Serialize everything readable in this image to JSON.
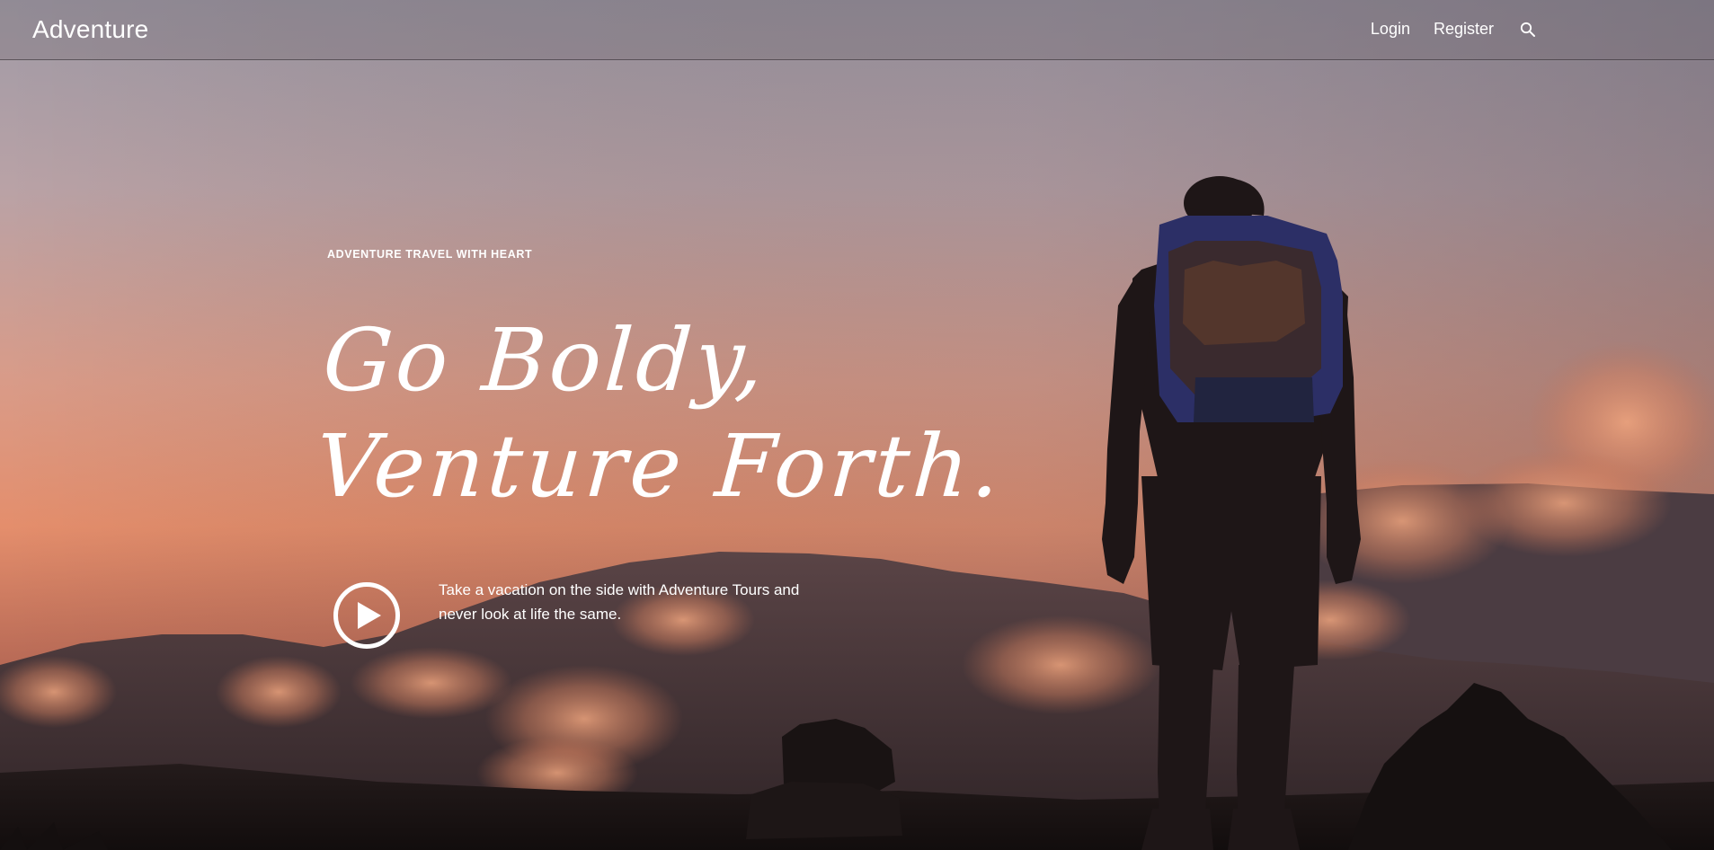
{
  "navbar": {
    "brand": "Adventure",
    "links": [
      {
        "label": "Login"
      },
      {
        "label": "Register"
      }
    ],
    "search_icon": "search-icon"
  },
  "hero": {
    "eyebrow": "ADVENTURE TRAVEL WITH HEART",
    "headline_line1": "Go Boldy,",
    "headline_line2": "Venture Forth.",
    "play_icon": "play-icon",
    "tagline": "Take a vacation on the side with Adventure Tours and never look at life the same."
  },
  "colors": {
    "sky_top": "#b9a2a6",
    "sky_glow": "#e7906e",
    "mountain": "#3d2f31",
    "text": "#ffffff"
  }
}
